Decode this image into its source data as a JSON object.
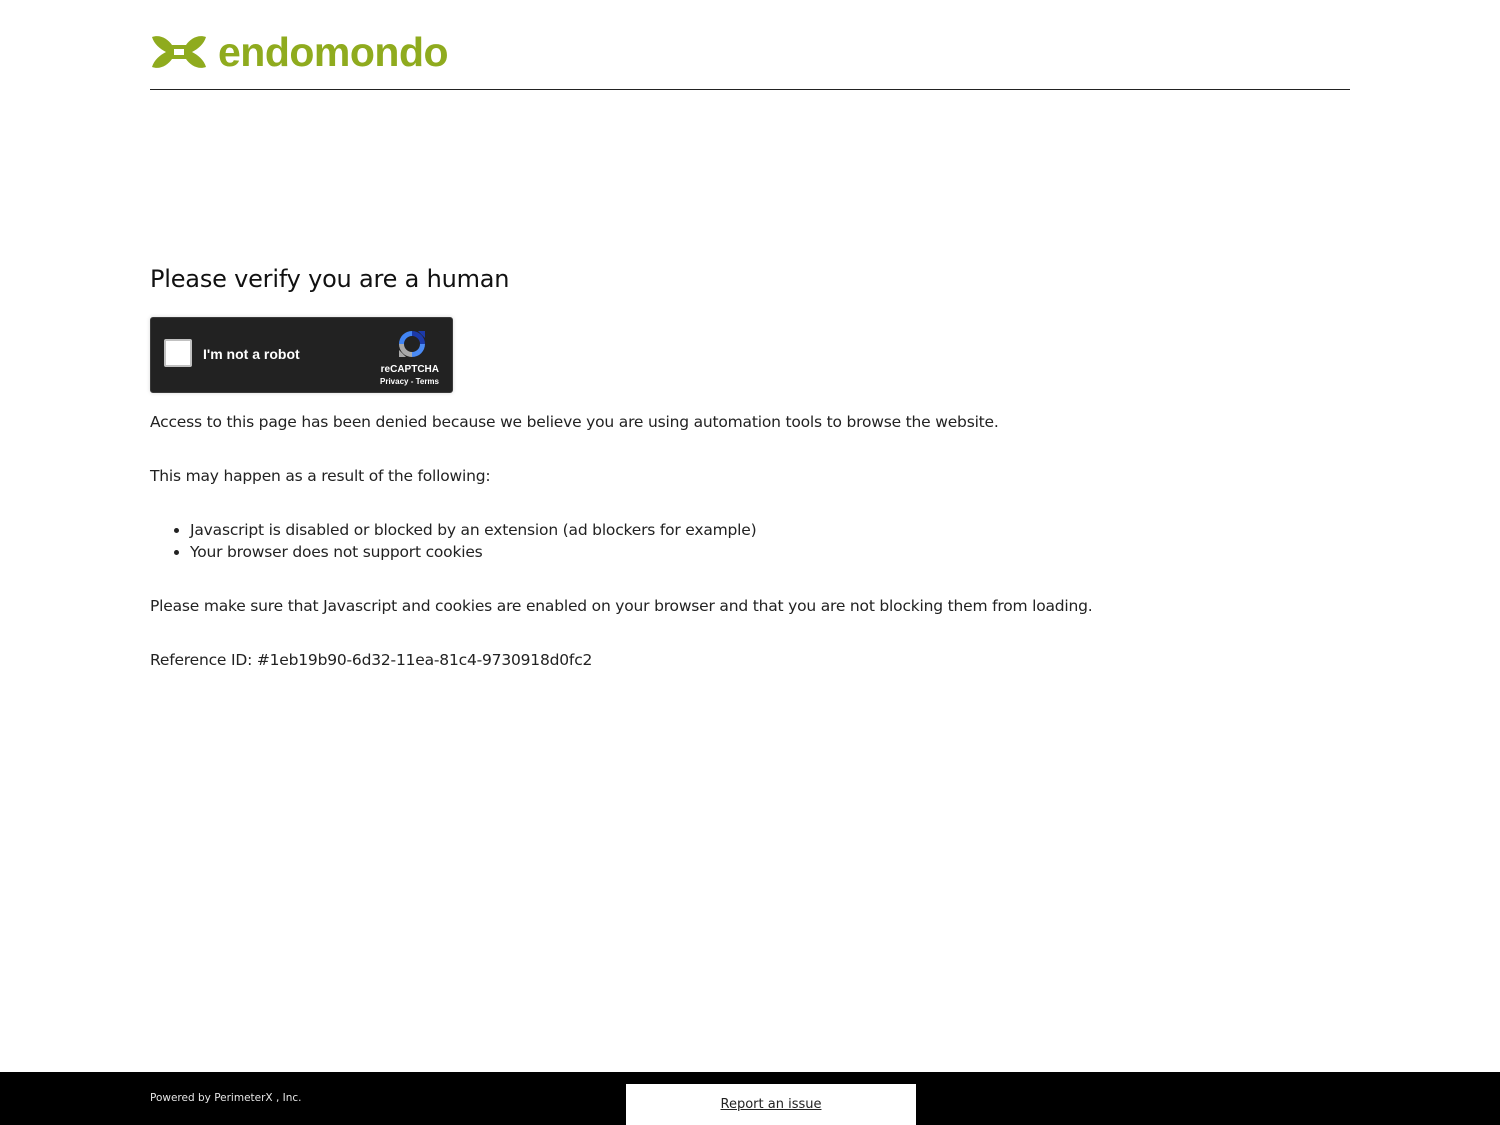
{
  "header": {
    "logo_text": "endomondo",
    "logo_icon": "under-armour-icon",
    "brand_color": "#8fab1e"
  },
  "main": {
    "title": "Please verify you are a human",
    "captcha": {
      "label": "I'm not a robot",
      "brand": "reCAPTCHA",
      "privacy": "Privacy",
      "separator": " - ",
      "terms": "Terms",
      "icon": "recaptcha-icon"
    },
    "access_denied": "Access to this page has been denied because we believe you are using automation tools to browse the website.",
    "may_happen": "This may happen as a result of the following:",
    "reasons": [
      "Javascript is disabled or blocked by an extension (ad blockers for example)",
      "Your browser does not support cookies"
    ],
    "make_sure": "Please make sure that Javascript and cookies are enabled on your browser and that you are not blocking them from loading.",
    "reference": "Reference ID: #1eb19b90-6d32-11ea-81c4-9730918d0fc2"
  },
  "footer": {
    "powered_by": "Powered by PerimeterX , Inc.",
    "report_label": "Report an issue"
  }
}
